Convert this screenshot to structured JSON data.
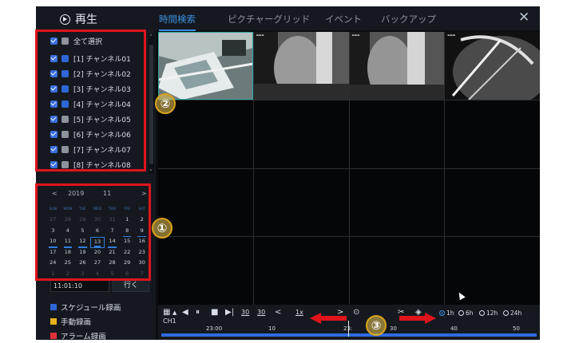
{
  "header": {
    "title": "再生",
    "tabs": [
      {
        "label": "時間検索",
        "active": true
      },
      {
        "label": "ピクチャーグリッド",
        "active": false
      },
      {
        "label": "イベント",
        "active": false
      },
      {
        "label": "バックアップ",
        "active": false
      }
    ]
  },
  "channels": {
    "select_all_label": "全て選択",
    "items": [
      {
        "label": "[1] チャンネル01",
        "icon": "blue"
      },
      {
        "label": "[2] チャンネル02",
        "icon": "blue"
      },
      {
        "label": "[3] チャンネル03",
        "icon": "blue"
      },
      {
        "label": "[4] チャンネル04",
        "icon": "blue"
      },
      {
        "label": "[5] チャンネル05",
        "icon": "gray"
      },
      {
        "label": "[6] チャンネル06",
        "icon": "gray"
      },
      {
        "label": "[7] チャンネル07",
        "icon": "gray"
      },
      {
        "label": "[8] チャンネル08",
        "icon": "gray"
      }
    ]
  },
  "calendar": {
    "year": "2019",
    "month": "11",
    "weekdays": [
      "SUN",
      "MON",
      "TUE",
      "WED",
      "THU",
      "FRI",
      "SAT"
    ],
    "days": [
      {
        "d": "27",
        "dim": true
      },
      {
        "d": "28",
        "dim": true
      },
      {
        "d": "29",
        "dim": true
      },
      {
        "d": "30",
        "dim": true
      },
      {
        "d": "31",
        "dim": true
      },
      {
        "d": "1"
      },
      {
        "d": "2"
      },
      {
        "d": "3"
      },
      {
        "d": "4"
      },
      {
        "d": "5"
      },
      {
        "d": "6"
      },
      {
        "d": "7"
      },
      {
        "d": "8",
        "rec": true
      },
      {
        "d": "9",
        "rec": true
      },
      {
        "d": "10",
        "rec": true
      },
      {
        "d": "11",
        "rec": true
      },
      {
        "d": "12",
        "rec": true
      },
      {
        "d": "13",
        "rec": true,
        "sel": true
      },
      {
        "d": "14",
        "rec": true
      },
      {
        "d": "15"
      },
      {
        "d": "16"
      },
      {
        "d": "17"
      },
      {
        "d": "18"
      },
      {
        "d": "19"
      },
      {
        "d": "20"
      },
      {
        "d": "21"
      },
      {
        "d": "22"
      },
      {
        "d": "23"
      },
      {
        "d": "24"
      },
      {
        "d": "25"
      },
      {
        "d": "26"
      },
      {
        "d": "27"
      },
      {
        "d": "28"
      },
      {
        "d": "29"
      },
      {
        "d": "30"
      },
      {
        "d": "1",
        "dim": true
      },
      {
        "d": "2",
        "dim": true
      },
      {
        "d": "3",
        "dim": true
      },
      {
        "d": "4",
        "dim": true
      },
      {
        "d": "5",
        "dim": true
      },
      {
        "d": "6",
        "dim": true
      },
      {
        "d": "7",
        "dim": true
      }
    ]
  },
  "jump": {
    "time": "11:01:10",
    "go_label": "行く"
  },
  "legend": [
    {
      "label": "スケジュール録画",
      "color": "#2f66d6"
    },
    {
      "label": "手動録画",
      "color": "#e8b21a"
    },
    {
      "label": "アラーム録画",
      "color": "#e0303a"
    }
  ],
  "controls": {
    "channel": "CH1",
    "speed": "1x",
    "skip_back": "30",
    "skip_fwd": "30",
    "ranges": [
      {
        "label": "1h",
        "selected": true
      },
      {
        "label": "6h",
        "selected": false
      },
      {
        "label": "12h",
        "selected": false
      },
      {
        "label": "24h",
        "selected": false
      }
    ],
    "timeline_labels": [
      "23:00",
      "10",
      "23:",
      "30",
      "40",
      "50"
    ]
  },
  "annotations": {
    "markers": [
      "①",
      "②",
      "③"
    ]
  },
  "colors": {
    "accent": "#3b8fe0",
    "highlight": "#e0141b",
    "marker": "#d9a21a"
  }
}
